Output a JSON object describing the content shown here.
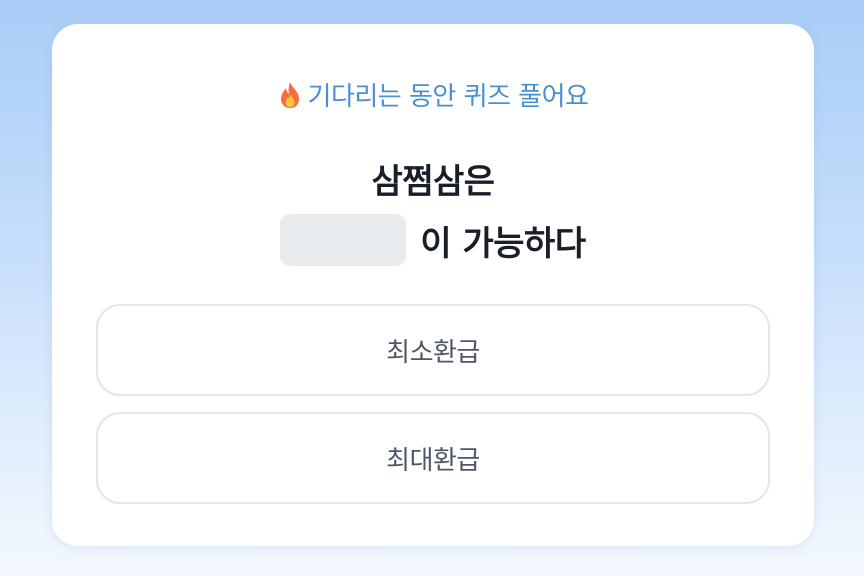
{
  "quiz": {
    "header": {
      "icon": "fire-icon",
      "text": "기다리는 동안 퀴즈 풀어요"
    },
    "question": {
      "line1": "삼쩜삼은",
      "suffix": "이 가능하다"
    },
    "options": [
      {
        "label": "최소환급"
      },
      {
        "label": "최대환급"
      }
    ]
  },
  "colors": {
    "accent": "#4a8fcf",
    "fire_outer": "#ff6b3d",
    "fire_inner": "#ffc83d",
    "text_primary": "#191f28",
    "text_secondary": "#4e5968",
    "blank_fill": "#e9ecee"
  }
}
